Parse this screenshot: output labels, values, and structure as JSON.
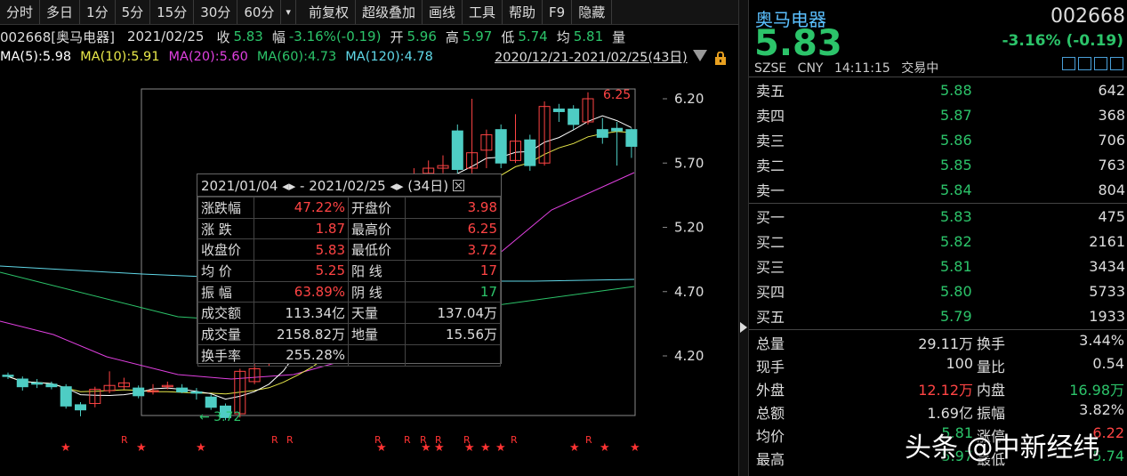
{
  "toolbar": {
    "buttons": [
      "分时",
      "多日",
      "1分",
      "5分",
      "15分",
      "30分",
      "60分",
      "▾",
      "前复权",
      "超级叠加",
      "画线",
      "工具",
      "帮助",
      "F9",
      "隐藏"
    ]
  },
  "info": {
    "code_name": "002668[奥马电器]",
    "date": "2021/02/25",
    "close_label": "收",
    "close": "5.83",
    "change_label": "幅",
    "change": "-3.16%(-0.19)",
    "open_label": "开",
    "open": "5.96",
    "high_label": "高",
    "high": "5.97",
    "low_label": "低",
    "low": "5.74",
    "avg_label": "均",
    "avg": "5.81",
    "vol_label": "量"
  },
  "ma": {
    "ma5": "MA(5):5.98",
    "ma10": "MA(10):5.91",
    "ma20": "MA(20):5.60",
    "ma60": "MA(60):4.73",
    "ma120": "MA(120):4.78"
  },
  "range_label": "2020/12/21-2021/02/25(43日)",
  "colors": {
    "up": "#ff4444",
    "down": "#2cc46a",
    "ma5": "#ffffff",
    "ma10": "#e8e84a",
    "ma20": "#e040e0",
    "ma60": "#2cc46a",
    "ma120": "#60d8e8",
    "name": "#5bc0ff"
  },
  "chart_data": {
    "type": "candlestick",
    "y_ticks": [
      "6.20",
      "5.70",
      "5.20",
      "4.70",
      "4.20"
    ],
    "ylim": [
      3.5,
      6.4
    ],
    "high_marker": "6.25",
    "low_marker": "3.72",
    "candles": [
      {
        "o": 4.05,
        "c": 4.04,
        "h": 4.07,
        "l": 4.02
      },
      {
        "o": 4.02,
        "c": 3.96,
        "h": 4.04,
        "l": 3.93
      },
      {
        "o": 3.99,
        "c": 3.98,
        "h": 4.02,
        "l": 3.95
      },
      {
        "o": 3.98,
        "c": 3.96,
        "h": 4.0,
        "l": 3.94
      },
      {
        "o": 3.96,
        "c": 3.81,
        "h": 3.98,
        "l": 3.79
      },
      {
        "o": 3.82,
        "c": 3.78,
        "h": 3.84,
        "l": 3.73
      },
      {
        "o": 3.83,
        "c": 3.94,
        "h": 3.96,
        "l": 3.8
      },
      {
        "o": 3.93,
        "c": 3.97,
        "h": 4.08,
        "l": 3.91
      },
      {
        "o": 3.96,
        "c": 3.99,
        "h": 4.03,
        "l": 3.94
      },
      {
        "o": 3.95,
        "c": 3.89,
        "h": 3.97,
        "l": 3.87
      },
      {
        "o": 3.92,
        "c": 3.93,
        "h": 3.98,
        "l": 3.9
      },
      {
        "o": 3.96,
        "c": 3.97,
        "h": 4.0,
        "l": 3.94
      },
      {
        "o": 3.95,
        "c": 3.92,
        "h": 3.98,
        "l": 3.91
      },
      {
        "o": 3.92,
        "c": 3.91,
        "h": 3.95,
        "l": 3.86
      },
      {
        "o": 3.88,
        "c": 3.8,
        "h": 3.9,
        "l": 3.78
      },
      {
        "o": 3.81,
        "c": 3.72,
        "h": 3.83,
        "l": 3.7
      },
      {
        "o": 3.75,
        "c": 4.08,
        "h": 4.1,
        "l": 3.72
      },
      {
        "o": 4.0,
        "c": 4.1,
        "h": 4.16,
        "l": 3.98
      },
      {
        "o": 4.15,
        "c": 4.2,
        "h": 4.25,
        "l": 4.12
      },
      {
        "o": 4.25,
        "c": 4.32,
        "h": 4.38,
        "l": 4.2
      },
      {
        "o": 4.45,
        "c": 4.5,
        "h": 4.58,
        "l": 4.4
      },
      {
        "o": 4.55,
        "c": 4.6,
        "h": 4.68,
        "l": 4.5
      },
      {
        "o": 4.7,
        "c": 4.75,
        "h": 4.82,
        "l": 4.65
      },
      {
        "o": 4.85,
        "c": 4.9,
        "h": 4.98,
        "l": 4.8
      },
      {
        "o": 5.0,
        "c": 5.05,
        "h": 5.12,
        "l": 4.95
      },
      {
        "o": 5.15,
        "c": 5.2,
        "h": 5.3,
        "l": 5.1
      },
      {
        "o": 5.3,
        "c": 5.35,
        "h": 5.45,
        "l": 5.25
      },
      {
        "o": 5.45,
        "c": 5.5,
        "h": 5.58,
        "l": 5.4
      },
      {
        "o": 5.55,
        "c": 5.6,
        "h": 5.66,
        "l": 5.5
      },
      {
        "o": 5.62,
        "c": 5.66,
        "h": 5.72,
        "l": 5.58
      },
      {
        "o": 5.66,
        "c": 5.68,
        "h": 5.76,
        "l": 5.62
      },
      {
        "o": 5.95,
        "c": 5.65,
        "h": 6.0,
        "l": 5.62
      },
      {
        "o": 5.66,
        "c": 5.78,
        "h": 6.2,
        "l": 5.62
      },
      {
        "o": 5.8,
        "c": 5.92,
        "h": 5.96,
        "l": 5.66
      },
      {
        "o": 5.96,
        "c": 5.7,
        "h": 6.0,
        "l": 5.66
      },
      {
        "o": 5.72,
        "c": 5.87,
        "h": 6.08,
        "l": 5.7
      },
      {
        "o": 5.88,
        "c": 5.68,
        "h": 5.92,
        "l": 5.64
      },
      {
        "o": 5.7,
        "c": 6.14,
        "h": 6.18,
        "l": 5.68
      },
      {
        "o": 6.12,
        "c": 6.1,
        "h": 6.16,
        "l": 6.02
      },
      {
        "o": 6.12,
        "c": 6.0,
        "h": 6.15,
        "l": 5.96
      },
      {
        "o": 6.02,
        "c": 6.2,
        "h": 6.25,
        "l": 6.0
      },
      {
        "o": 5.96,
        "c": 5.9,
        "h": 6.05,
        "l": 5.85
      },
      {
        "o": 5.97,
        "c": 5.95,
        "h": 6.02,
        "l": 5.68
      },
      {
        "o": 5.96,
        "c": 5.83,
        "h": 5.97,
        "l": 5.74
      }
    ]
  },
  "popup": {
    "range": "2021/01/04 ◂▸ - 2021/02/25 ◂▸  (34日)",
    "rows": [
      {
        "k": "涨跌幅",
        "v": "47.22%",
        "vc": "red",
        "k2": "开盘价",
        "v2": "3.98",
        "v2c": "red"
      },
      {
        "k": "涨  跌",
        "v": "1.87",
        "vc": "red",
        "k2": "最高价",
        "v2": "6.25",
        "v2c": "red"
      },
      {
        "k": "收盘价",
        "v": "5.83",
        "vc": "red",
        "k2": "最低价",
        "v2": "3.72",
        "v2c": "red"
      },
      {
        "k": "均  价",
        "v": "5.25",
        "vc": "red",
        "k2": "阳  线",
        "v2": "17",
        "v2c": "red"
      },
      {
        "k": "振  幅",
        "v": "63.89%",
        "vc": "red",
        "k2": "阴  线",
        "v2": "17",
        "v2c": "green"
      },
      {
        "k": "成交额",
        "v": "113.34亿",
        "vc": "white",
        "k2": "天量",
        "v2": "137.04万",
        "v2c": "white"
      },
      {
        "k": "成交量",
        "v": "2158.82万",
        "vc": "white",
        "k2": "地量",
        "v2": "15.56万",
        "v2c": "white"
      },
      {
        "k": "换手率",
        "v": "255.28%",
        "vc": "white",
        "k2": "",
        "v2": "",
        "v2c": "white"
      }
    ]
  },
  "right": {
    "name": "奥马电器",
    "code": "002668",
    "price": "5.83",
    "change": "-3.16% (-0.19)",
    "market": "SZSE",
    "currency": "CNY",
    "time": "14:11:15",
    "status": "交易中",
    "asks": [
      {
        "n": "卖五",
        "p": "5.88",
        "q": "642"
      },
      {
        "n": "卖四",
        "p": "5.87",
        "q": "368"
      },
      {
        "n": "卖三",
        "p": "5.86",
        "q": "706"
      },
      {
        "n": "卖二",
        "p": "5.85",
        "q": "763"
      },
      {
        "n": "卖一",
        "p": "5.84",
        "q": "804"
      }
    ],
    "bids": [
      {
        "n": "买一",
        "p": "5.83",
        "q": "475"
      },
      {
        "n": "买二",
        "p": "5.82",
        "q": "2161"
      },
      {
        "n": "买三",
        "p": "5.81",
        "q": "3434"
      },
      {
        "n": "买四",
        "p": "5.80",
        "q": "5733"
      },
      {
        "n": "买五",
        "p": "5.79",
        "q": "1933"
      }
    ],
    "stats": [
      {
        "k1": "总量",
        "v1": "29.11万",
        "c1": "white",
        "k2": "换手",
        "v2": "3.44%",
        "c2": "white"
      },
      {
        "k1": "现手",
        "v1": "100",
        "c1": "white",
        "k2": "量比",
        "v2": "0.54",
        "c2": "white"
      },
      {
        "k1": "外盘",
        "v1": "12.12万",
        "c1": "red",
        "k2": "内盘",
        "v2": "16.98万",
        "c2": "green"
      },
      {
        "k1": "总额",
        "v1": "1.69亿",
        "c1": "white",
        "k2": "振幅",
        "v2": "3.82%",
        "c2": "white"
      },
      {
        "k1": "均价",
        "v1": "5.81",
        "c1": "green",
        "k2": "涨停",
        "v2": "6.22",
        "c2": "red"
      },
      {
        "k1": "最高",
        "v1": "5.97",
        "c1": "green",
        "k2": "最低",
        "v2": "5.74",
        "c2": "green"
      }
    ]
  },
  "watermark": "头条 @中新经纬"
}
